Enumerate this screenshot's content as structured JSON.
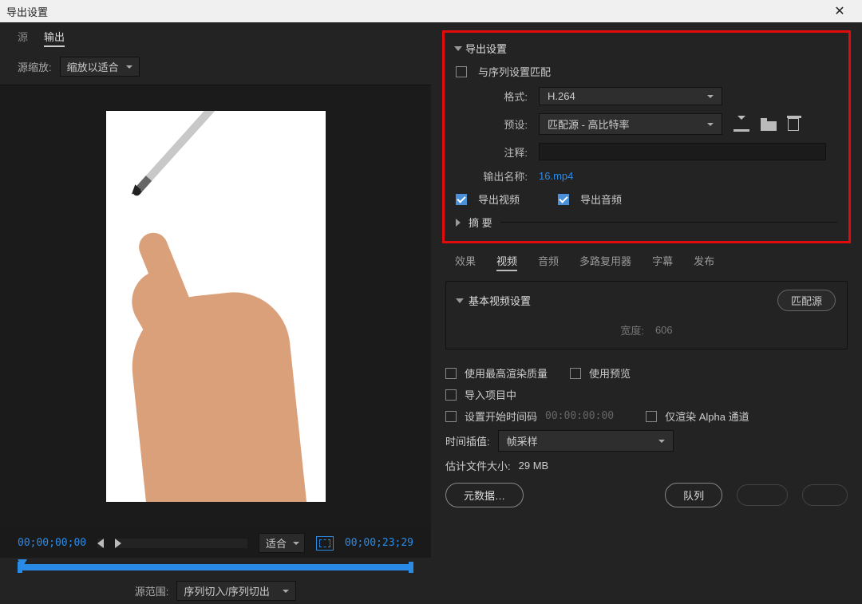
{
  "titlebar": {
    "title": "导出设置",
    "close": "✕"
  },
  "left": {
    "tabs": {
      "source": "源",
      "output": "输出"
    },
    "scale_label": "源缩放:",
    "scale_value": "缩放以适合",
    "fit_label": "适合",
    "tc_start": "00;00;00;00",
    "tc_end": "00;00;23;29",
    "range_label": "源范围:",
    "range_value": "序列切入/序列切出"
  },
  "export": {
    "section_title": "导出设置",
    "match_seq": "与序列设置匹配",
    "format_label": "格式:",
    "format_value": "H.264",
    "preset_label": "预设:",
    "preset_value": "匹配源 - 高比特率",
    "comment_label": "注释:",
    "output_name_label": "输出名称:",
    "output_name_value": "16.mp4",
    "export_video": "导出视频",
    "export_audio": "导出音频",
    "summary": "摘 要"
  },
  "mid_tabs": {
    "effects": "效果",
    "video": "视频",
    "audio": "音频",
    "mux": "多路复用器",
    "captions": "字幕",
    "publish": "发布"
  },
  "video": {
    "section": "基本视频设置",
    "match_source": "匹配源",
    "width_label": "宽度:",
    "width_value": "606"
  },
  "bottom": {
    "max_quality": "使用最高渲染质量",
    "use_preview": "使用预览",
    "import_project": "导入项目中",
    "set_start_tc": "设置开始时间码",
    "start_tc_value": "00:00:00:00",
    "alpha_only": "仅渲染 Alpha 通道",
    "interp_label": "时间插值:",
    "interp_value": "帧采样",
    "est_size_label": "估计文件大小:",
    "est_size_value": "29 MB",
    "btn_metadata": "元数据…",
    "btn_queue": "队列"
  }
}
